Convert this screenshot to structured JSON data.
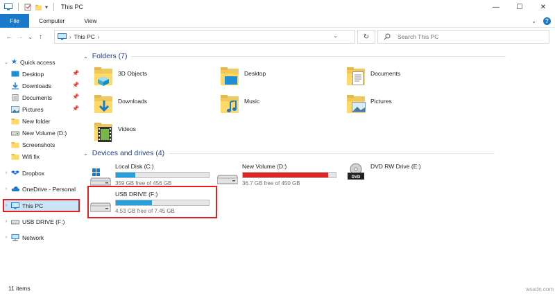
{
  "window": {
    "title": "This PC",
    "controls": {
      "minimize": "—",
      "maximize": "☐",
      "close": "✕"
    }
  },
  "ribbon": {
    "tabs": [
      "File",
      "Computer",
      "View"
    ]
  },
  "nav": {
    "back": "←",
    "forward": "→",
    "recent": "⌄",
    "up": "↑"
  },
  "address": {
    "crumb": "This PC",
    "refresh": "↻"
  },
  "search": {
    "placeholder": "Search This PC"
  },
  "sidebar": {
    "quick_access": "Quick access",
    "pinned": [
      {
        "label": "Desktop",
        "pinned": true,
        "icon": "desktop-icon"
      },
      {
        "label": "Downloads",
        "pinned": true,
        "icon": "downloads-icon"
      },
      {
        "label": "Documents",
        "pinned": true,
        "icon": "documents-icon"
      },
      {
        "label": "Pictures",
        "pinned": true,
        "icon": "pictures-icon"
      },
      {
        "label": "New folder",
        "pinned": false,
        "icon": "folder-icon"
      },
      {
        "label": "New Volume (D:)",
        "pinned": false,
        "icon": "drive-icon"
      },
      {
        "label": "Screenshots",
        "pinned": false,
        "icon": "folder-icon"
      },
      {
        "label": "Wifi fix",
        "pinned": false,
        "icon": "folder-icon"
      }
    ],
    "dropbox": "Dropbox",
    "onedrive": "OneDrive - Personal",
    "this_pc": "This PC",
    "usb": "USB DRIVE (F:)",
    "network": "Network"
  },
  "folders": {
    "header": "Folders (7)",
    "items": [
      "3D Objects",
      "Desktop",
      "Documents",
      "Downloads",
      "Music",
      "Pictures",
      "Videos"
    ]
  },
  "drives": {
    "header": "Devices and drives (4)",
    "items": [
      {
        "name": "Local Disk (C:)",
        "free": "359 GB free of 456 GB",
        "used_fraction": 0.21,
        "bar_color": "#26a0da"
      },
      {
        "name": "New Volume (D:)",
        "free": "36.7 GB free of 450 GB",
        "used_fraction": 0.92,
        "bar_color": "#da2626"
      },
      {
        "name": "DVD RW Drive (E:)",
        "free": "",
        "used_fraction": null,
        "bar_color": ""
      },
      {
        "name": "USB DRIVE (F:)",
        "free": "4.53 GB free of 7.45 GB",
        "used_fraction": 0.39,
        "bar_color": "#26a0da"
      }
    ]
  },
  "status": {
    "count": "11 items"
  },
  "watermark": "wsxdn.com"
}
